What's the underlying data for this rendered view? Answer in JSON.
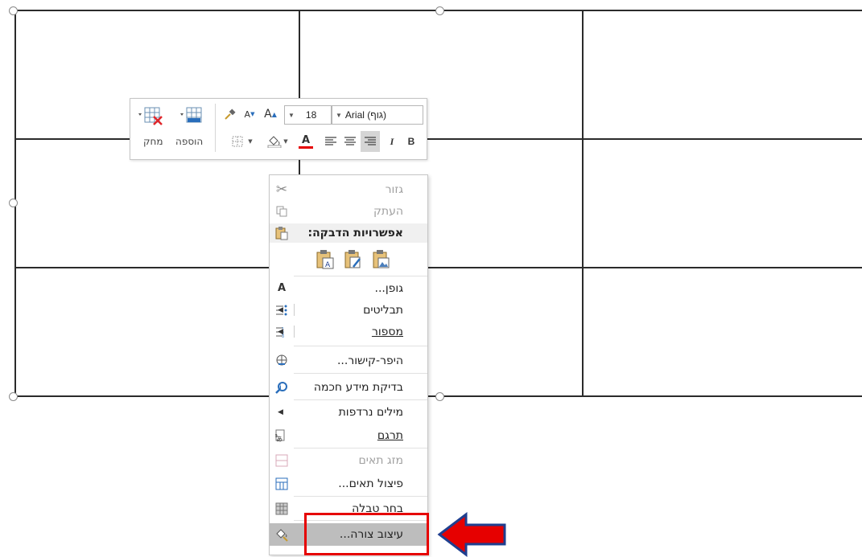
{
  "toolbar": {
    "font_name": "Arial (גוף)",
    "font_size": "18",
    "grow_font": "A",
    "shrink_font": "A",
    "bold": "B",
    "italic": "I",
    "font_color": "A",
    "insert_label": "הוספה",
    "delete_label": "מחק"
  },
  "menu": {
    "cut": "גזור",
    "copy": "העתק",
    "paste_options": "אפשרויות הדבקה:",
    "font": "גופן...",
    "bullets": "תבליטים",
    "numbering": "מספור",
    "hyperlink": "היפר-קישור...",
    "smart_lookup": "בדיקת מידע חכמה",
    "synonyms": "מילים נרדפות",
    "translate": "תרגם",
    "merge_cells": "מזג תאים",
    "split_cells": "פיצול תאים...",
    "select_table": "בחר טבלה",
    "format_shape": "עיצוב צורה..."
  },
  "colors": {
    "highlight_box": "#e60000",
    "arrow_fill": "#e60000",
    "arrow_stroke": "#1f3f8f",
    "menu_highlight": "#bdbdbd"
  }
}
